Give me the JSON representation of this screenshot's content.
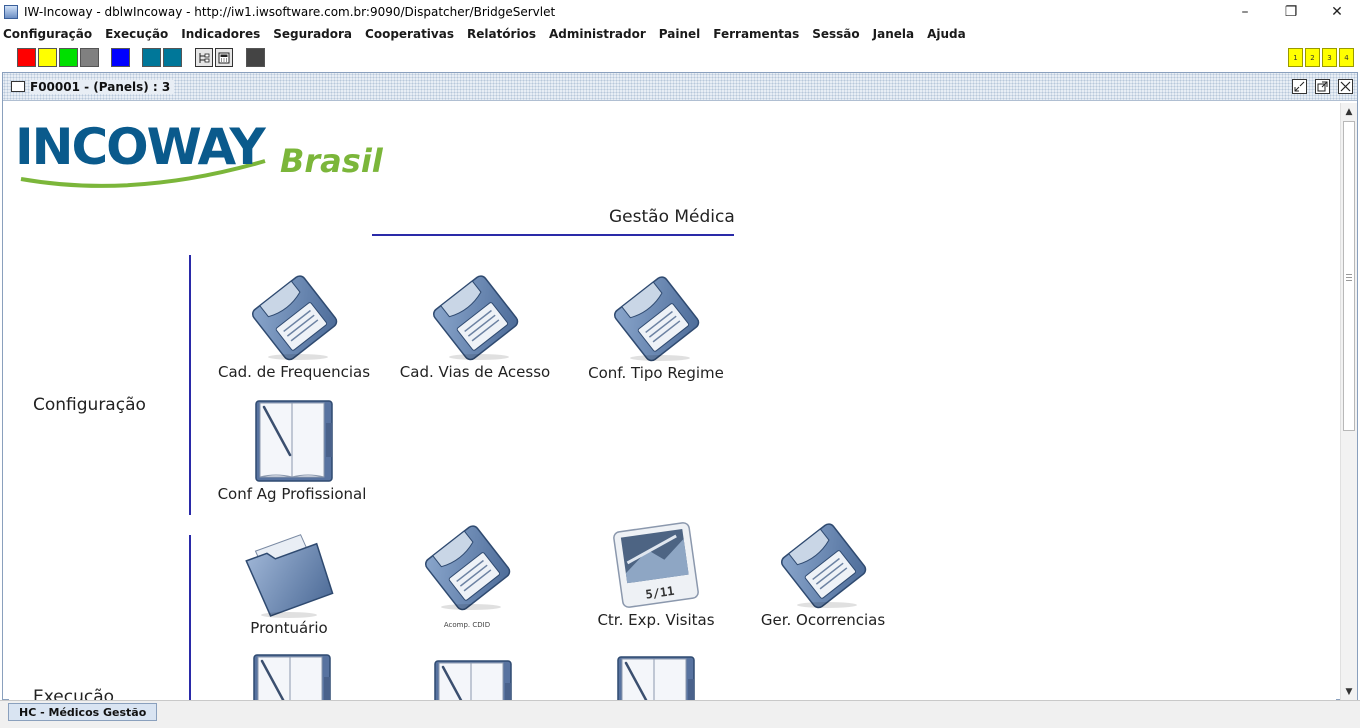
{
  "window": {
    "title": "IW-Incoway - dblwIncoway - http://iw1.iwsoftware.com.br:9090/Dispatcher/BridgeServlet",
    "minimize_glyph": "–",
    "restore_glyph": "❐",
    "close_glyph": "✕"
  },
  "menu": [
    "Configuração",
    "Execução",
    "Indicadores",
    "Seguradora",
    "Cooperativas",
    "Relatórios",
    "Administrador",
    "Painel",
    "Ferramentas",
    "Sessão",
    "Janela",
    "Ajuda"
  ],
  "toolbar": {
    "swatches": [
      "#ff0000",
      "#ffff00",
      "#00e000",
      "#808080",
      "#0000ff",
      "#007799",
      "#007799",
      "#444444"
    ],
    "quick_buttons": [
      "1",
      "2",
      "3",
      "4"
    ]
  },
  "frame": {
    "title": "F00001 - (Panels) : 3"
  },
  "logo": {
    "main": "INCOWAY",
    "sub": "Brasil",
    "main_color": "#0a5a8c",
    "sub_color": "#7bb63a"
  },
  "page": {
    "heading": "Gestão Médica",
    "accent_color": "#2a2aa8"
  },
  "sections": [
    {
      "label": "Configuração",
      "items": [
        {
          "label": "Cad. de Frequencias",
          "icon": "floppy-disk-icon"
        },
        {
          "label": "Cad. Vias de Acesso",
          "icon": "floppy-disk-icon"
        },
        {
          "label": "Conf. Tipo Regime",
          "icon": "floppy-disk-icon"
        },
        {
          "label": "Conf Ag Profissional",
          "icon": "notebook-icon"
        }
      ]
    },
    {
      "label": "Execução",
      "items": [
        {
          "label": "Prontuário",
          "icon": "folder-icon"
        },
        {
          "label": "Acomp. CDID",
          "icon": "floppy-disk-icon"
        },
        {
          "label": "Ctr. Exp. Visitas",
          "icon": "photo-icon",
          "photo_caption": "5/11"
        },
        {
          "label": "Ger. Ocorrencias",
          "icon": "floppy-disk-icon"
        },
        {
          "label": "",
          "icon": "notebook-icon"
        },
        {
          "label": "",
          "icon": "notebook-icon"
        },
        {
          "label": "",
          "icon": "notebook-icon"
        }
      ]
    }
  ],
  "statusbar": {
    "task": "HC - Médicos Gestão"
  }
}
